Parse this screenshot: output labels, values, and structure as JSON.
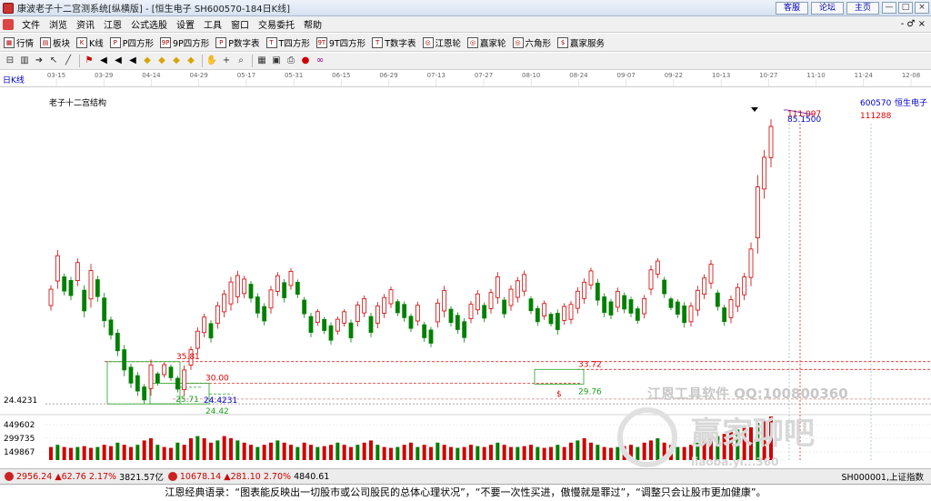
{
  "window": {
    "title": "康波老子十二宫测系统[纵横版] - [恒生电子  SH600570-184日K线]",
    "links": [
      "客服",
      "论坛",
      "主页"
    ],
    "controls": [
      "—",
      "□",
      "×"
    ]
  },
  "menu": {
    "items": [
      "文件",
      "浏览",
      "资讯",
      "江恩",
      "公式选股",
      "设置",
      "工具",
      "窗口",
      "交易委托",
      "帮助"
    ],
    "right_controls": "- ♂ ×"
  },
  "toolbar": {
    "buttons": [
      {
        "icon": "grid-icon",
        "label": "行情"
      },
      {
        "icon": "block-icon",
        "label": "板块"
      },
      {
        "icon": "kline-icon",
        "label": "K线"
      },
      {
        "icon": "p-square-icon",
        "label": "P四方形"
      },
      {
        "icon": "9p-square-icon",
        "label": "9P四方形"
      },
      {
        "icon": "p-table-icon",
        "label": "P数字表"
      },
      {
        "icon": "t-square-icon",
        "label": "T四方形"
      },
      {
        "icon": "9t-square-icon",
        "label": "9T四方形"
      },
      {
        "icon": "t-table-icon",
        "label": "T数字表"
      },
      {
        "icon": "gann-wheel-icon",
        "label": "江恩轮"
      },
      {
        "icon": "yingjia-wheel-icon",
        "label": "赢家轮"
      },
      {
        "icon": "hexagon-icon",
        "label": "六角形"
      },
      {
        "icon": "dollar-icon",
        "label": "赢家服务"
      }
    ]
  },
  "drawing_tools": {
    "icons": [
      "frame-icon",
      "chart-icon",
      "arrow-icon",
      "cursor-icon",
      "line-icon",
      "flag-icon",
      "triangle-icon",
      "triangle-icon",
      "triangle-icon",
      "diamond-icon",
      "diamond-icon",
      "diamond-icon",
      "diamond-icon",
      "hand-icon",
      "plus-icon",
      "zoom-icon",
      "calendar-icon",
      "save-icon",
      "print-icon",
      "color-icon",
      "infinity-icon"
    ]
  },
  "time_axis": {
    "labels": [
      "03-15",
      "03-29",
      "04-14",
      "04-29",
      "05-17",
      "05-31",
      "06-15",
      "06-29",
      "07-13",
      "07-27",
      "08-10",
      "08-24",
      "09-07",
      "09-22",
      "10-13",
      "10-27",
      "11-10",
      "11-24",
      "12-08"
    ]
  },
  "chart": {
    "period_label": "日K线",
    "structure_label": "老子十二宫结构",
    "stock_code": "600570",
    "stock_name": "恒生电子",
    "y_axis_low": "24.4231",
    "volume_axis": [
      "449602",
      "299735",
      "149867"
    ],
    "annotations": {
      "high_35_81": "35.81",
      "level_30_00": "30.00",
      "low_24_4231": "24.4231",
      "low_24_42": "24.42",
      "box_low_25_71": "25.71",
      "level_33_72": "33.72",
      "box_low_29_76": "29.76",
      "high_right": "111.097",
      "high_right2": "85.1500",
      "right_price": "111288",
      "s_mark": "$"
    },
    "watermark": {
      "brand": "江恩工具软件  QQ:100800360",
      "logo_text": "赢家聊吧",
      "url": "liaoba.yi...360"
    }
  },
  "chart_data": {
    "type": "candlestick",
    "title": "恒生电子 SH600570 日K线",
    "price_levels": [
      35.81,
      33.72,
      30.0,
      29.76,
      25.71,
      24.4231,
      24.42
    ],
    "candles": [
      [
        49.6,
        56.4
      ],
      [
        55.5,
        66.0
      ],
      [
        53.7,
        59.6
      ],
      [
        52.4,
        58.7
      ],
      [
        56.2,
        63.7
      ],
      [
        47.8,
        56.4
      ],
      [
        50.4,
        62.2
      ],
      [
        52.0,
        59.0
      ],
      [
        45.0,
        54.4
      ],
      [
        41.8,
        48.0
      ],
      [
        37.3,
        44.6
      ],
      [
        31.9,
        40.3
      ],
      [
        28.7,
        35.3
      ],
      [
        26.6,
        33.0
      ],
      [
        24.4,
        29.8
      ],
      [
        26.6,
        36.4
      ],
      [
        29.3,
        33.1
      ],
      [
        31.5,
        35.6
      ],
      [
        30.6,
        35.0
      ],
      [
        27.5,
        32.0
      ],
      [
        26.6,
        34.8
      ],
      [
        33.6,
        40.0
      ],
      [
        38.0,
        45.1
      ],
      [
        42.4,
        48.8
      ],
      [
        41.0,
        47.0
      ],
      [
        44.7,
        52.0
      ],
      [
        47.8,
        55.2
      ],
      [
        49.6,
        58.7
      ],
      [
        51.6,
        60.4
      ],
      [
        53.0,
        59.0
      ],
      [
        51.8,
        57.6
      ],
      [
        47.6,
        54.3
      ],
      [
        45.6,
        51.6
      ],
      [
        48.8,
        56.3
      ],
      [
        53.5,
        60.0
      ],
      [
        51.8,
        58.1
      ],
      [
        55.2,
        61.1
      ],
      [
        53.0,
        58.0
      ],
      [
        47.6,
        53.3
      ],
      [
        42.4,
        49.0
      ],
      [
        45.5,
        50.0
      ],
      [
        43.3,
        47.9
      ],
      [
        40.4,
        46.4
      ],
      [
        43.1,
        48.0
      ],
      [
        45.3,
        50.0
      ],
      [
        41.0,
        47.2
      ],
      [
        45.3,
        52.1
      ],
      [
        47.8,
        53.7
      ],
      [
        42.4,
        49.0
      ],
      [
        44.8,
        51.9
      ],
      [
        47.6,
        54.1
      ],
      [
        50.3,
        56.1
      ],
      [
        48.1,
        52.7
      ],
      [
        46.6,
        52.1
      ],
      [
        43.8,
        48.8
      ],
      [
        45.5,
        52.0
      ],
      [
        41.2,
        46.6
      ],
      [
        39.7,
        45.2
      ],
      [
        45.0,
        52.8
      ],
      [
        47.8,
        56.3
      ],
      [
        45.3,
        50.8
      ],
      [
        43.3,
        49.2
      ],
      [
        41.0,
        47.6
      ],
      [
        46.2,
        52.2
      ],
      [
        48.5,
        55.1
      ],
      [
        46.5,
        51.8
      ],
      [
        48.8,
        55.5
      ],
      [
        51.4,
        60.0
      ],
      [
        47.6,
        53.3
      ],
      [
        49.6,
        56.4
      ],
      [
        51.8,
        58.7
      ],
      [
        53.5,
        60.4
      ],
      [
        48.6,
        53.5
      ],
      [
        45.5,
        51.0
      ],
      [
        47.1,
        52.3
      ],
      [
        45.3,
        49.2
      ],
      [
        43.1,
        49.9
      ],
      [
        45.8,
        51.6
      ],
      [
        46.0,
        52.2
      ],
      [
        48.8,
        55.9
      ],
      [
        51.5,
        58.3
      ],
      [
        55.3,
        61.2
      ],
      [
        51.0,
        58.1
      ],
      [
        47.8,
        54.3
      ],
      [
        47.3,
        52.8
      ],
      [
        49.2,
        55.8
      ],
      [
        48.9,
        54.5
      ],
      [
        47.8,
        53.4
      ],
      [
        46.0,
        50.8
      ],
      [
        47.5,
        53.8
      ],
      [
        53.8,
        61.8
      ],
      [
        58.4,
        63.8
      ],
      [
        53.0,
        58.7
      ],
      [
        49.7,
        53.3
      ],
      [
        47.6,
        52.7
      ],
      [
        45.0,
        51.9
      ],
      [
        45.3,
        51.8
      ],
      [
        48.1,
        56.3
      ],
      [
        52.7,
        59.4
      ],
      [
        55.5,
        63.3
      ],
      [
        49.6,
        55.2
      ],
      [
        45.5,
        51.2
      ],
      [
        46.2,
        53.7
      ],
      [
        49.2,
        57.0
      ],
      [
        52.4,
        59.8
      ],
      [
        56.2,
        68.0
      ],
      [
        65.0,
        86.2
      ],
      [
        79.8,
        93.0
      ],
      [
        88.3,
        101.3
      ]
    ],
    "volume_labels": [
      "449602",
      "299735",
      "149867"
    ],
    "volumes": [
      0.3,
      0.35,
      0.3,
      0.28,
      0.3,
      0.32,
      0.28,
      0.3,
      0.35,
      0.32,
      0.4,
      0.35,
      0.3,
      0.35,
      0.45,
      0.5,
      0.35,
      0.3,
      0.28,
      0.4,
      0.35,
      0.5,
      0.55,
      0.5,
      0.4,
      0.45,
      0.55,
      0.5,
      0.45,
      0.4,
      0.35,
      0.3,
      0.35,
      0.4,
      0.45,
      0.4,
      0.35,
      0.3,
      0.4,
      0.35,
      0.3,
      0.32,
      0.35,
      0.4,
      0.35,
      0.3,
      0.35,
      0.4,
      0.45,
      0.35,
      0.3,
      0.28,
      0.3,
      0.35,
      0.4,
      0.3,
      0.35,
      0.3,
      0.4,
      0.35,
      0.3,
      0.28,
      0.3,
      0.35,
      0.32,
      0.3,
      0.35,
      0.4,
      0.35,
      0.3,
      0.3,
      0.32,
      0.35,
      0.3,
      0.28,
      0.3,
      0.35,
      0.3,
      0.4,
      0.45,
      0.5,
      0.4,
      0.35,
      0.3,
      0.28,
      0.3,
      0.32,
      0.35,
      0.3,
      0.4,
      0.45,
      0.5,
      0.4,
      0.35,
      0.3,
      0.3,
      0.35,
      0.4,
      0.45,
      0.5,
      0.55,
      0.6,
      0.65,
      0.7,
      0.8,
      0.75,
      0.85,
      0.9,
      1.0
    ]
  },
  "status": {
    "sh_index": "2956.24",
    "sh_change": "▲62.76",
    "sh_pct": "2.17%",
    "sh_amount": "3821.57亿",
    "sz_index": "10678.14",
    "sz_change": "▲281.10",
    "sz_pct": "2.70%",
    "sz_amount": "4840.61",
    "right_text": "SH000001,上证指数"
  },
  "quote": {
    "text": "江恩经典语录：“图表能反映出一切股市或公司股民的总体心理状况”，“不要一次性买进，傲慢就是罪过”，“调整只会让股市更加健康”。"
  },
  "colors": {
    "up": "#d00000",
    "down": "#008000",
    "box": "#20a020",
    "level_red": "#e00000",
    "level_blue": "#0000cc"
  }
}
